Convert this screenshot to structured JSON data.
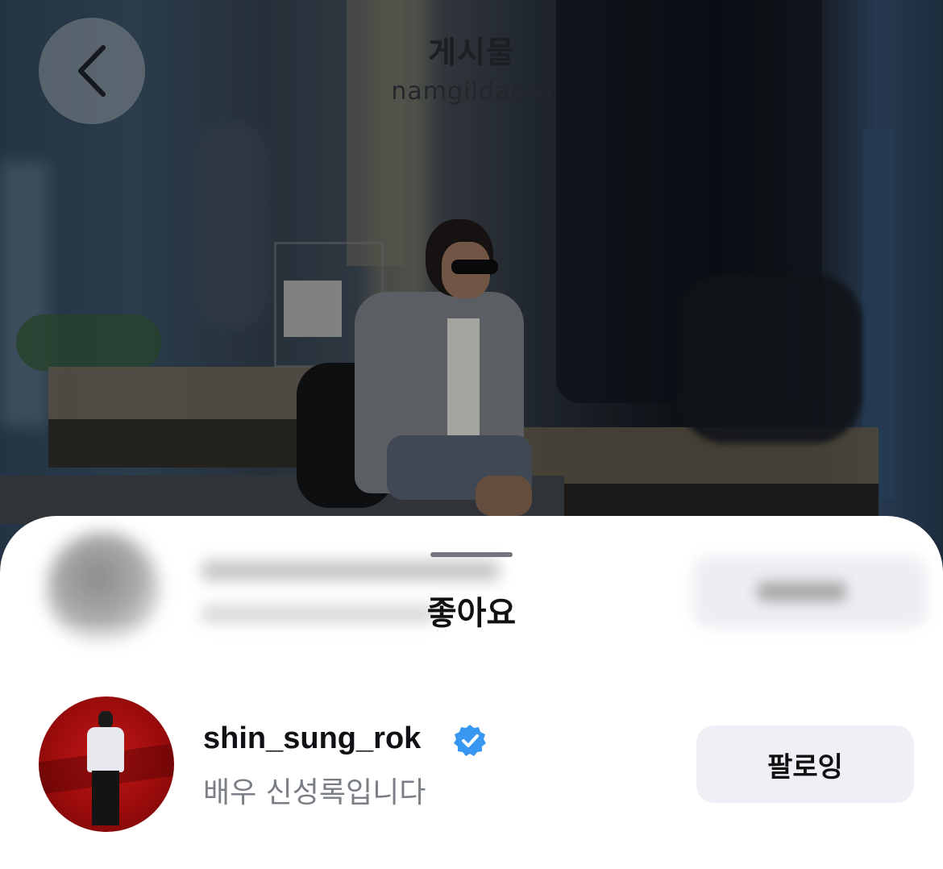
{
  "header": {
    "title": "게시물",
    "subtitle": "namgildaero",
    "back_icon": "chevron-left-icon"
  },
  "sheet": {
    "title": "좋아요",
    "user": {
      "username": "shin_sung_rok",
      "verified": true,
      "bio": "배우 신성록입니다",
      "follow_button": "팔로잉"
    }
  },
  "colors": {
    "verified_badge": "#3897f0",
    "follow_button_bg": "#eff0f5",
    "bio_text": "#7a7e85"
  }
}
